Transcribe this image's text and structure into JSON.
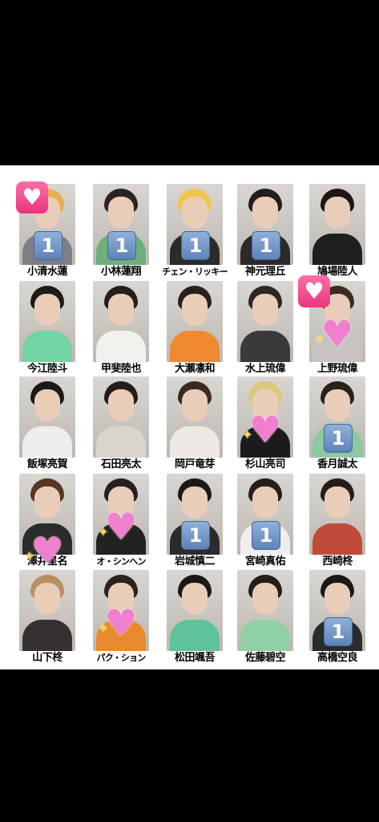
{
  "grid": {
    "rows": [
      [
        {
          "name": "小清水蓮",
          "badge": "heart",
          "badge2": "one",
          "hair": "#e6b04c",
          "body": "#7c7f86"
        },
        {
          "name": "小林蓮翔",
          "badge": "one",
          "hair": "#2c2320",
          "body": "#6fae7a"
        },
        {
          "name": "チェン・リッキー",
          "badge": "one",
          "hair": "#efc64a",
          "body": "#2b2b2b"
        },
        {
          "name": "神元理丘",
          "badge": "one",
          "hair": "#241d1a",
          "body": "#2a2a2a"
        },
        {
          "name": "鳩場陸人",
          "badge": "",
          "hair": "#1d1816",
          "body": "#1f1f1f"
        }
      ],
      [
        {
          "name": "今江陸斗",
          "badge": "",
          "hair": "#1f1a18",
          "body": "#74d3a3"
        },
        {
          "name": "甲斐陸也",
          "badge": "",
          "hair": "#251e1b",
          "body": "#f1f1ee"
        },
        {
          "name": "大瀬凛和",
          "badge": "",
          "hair": "#2a201c",
          "body": "#f08a2e"
        },
        {
          "name": "水上琉偉",
          "badge": "",
          "hair": "#2d2624",
          "body": "#3a3a3a"
        },
        {
          "name": "上野琉偉",
          "badge": "heart",
          "badge2": "sparkle",
          "hair": "#3a2c22",
          "body": "#c7c3c0"
        }
      ],
      [
        {
          "name": "飯塚亮賀",
          "badge": "",
          "hair": "#1e1917",
          "body": "#eeeeee"
        },
        {
          "name": "石田亮太",
          "badge": "",
          "hair": "#231c1a",
          "body": "#d9d4cc"
        },
        {
          "name": "岡戸竜芽",
          "badge": "",
          "hair": "#3a2a22",
          "body": "#ece9e4"
        },
        {
          "name": "杉山亮司",
          "badge": "sparkle",
          "hair": "#d8c97c",
          "body": "#1b1b1b"
        },
        {
          "name": "香月誠太",
          "badge": "one",
          "hair": "#2a211c",
          "body": "#8cc9a1"
        }
      ],
      [
        {
          "name": "澤井星名",
          "badge": "sparkle",
          "hair": "#5a3622",
          "body": "#2b2b2b"
        },
        {
          "name": "オ・シンヘン",
          "badge": "sparkle",
          "hair": "#262020",
          "body": "#222"
        },
        {
          "name": "岩城慎二",
          "badge": "one",
          "hair": "#1e1917",
          "body": "#2b2b2b"
        },
        {
          "name": "宮崎真佑",
          "badge": "one",
          "hair": "#251e1b",
          "body": "#eeeeee"
        },
        {
          "name": "西崎柊",
          "badge": "",
          "hair": "#241d1a",
          "body": "#c04a3a"
        }
      ],
      [
        {
          "name": "山下柊",
          "badge": "",
          "hair": "#b88f60",
          "body": "#353030"
        },
        {
          "name": "パク・ション",
          "badge": "sparkle",
          "hair": "#2b2220",
          "body": "#e98a2e"
        },
        {
          "name": "松田颯吾",
          "badge": "",
          "hair": "#1c1715",
          "body": "#5ec39b"
        },
        {
          "name": "佐藤碧空",
          "badge": "",
          "hair": "#241d1a",
          "body": "#8fd0a6"
        },
        {
          "name": "高橋空良",
          "badge": "one",
          "hair": "#1d1816",
          "body": "#2b2b2b"
        }
      ]
    ],
    "one_label": "1",
    "heart_glyph": "♥",
    "sparkle_glyph": "♥"
  }
}
